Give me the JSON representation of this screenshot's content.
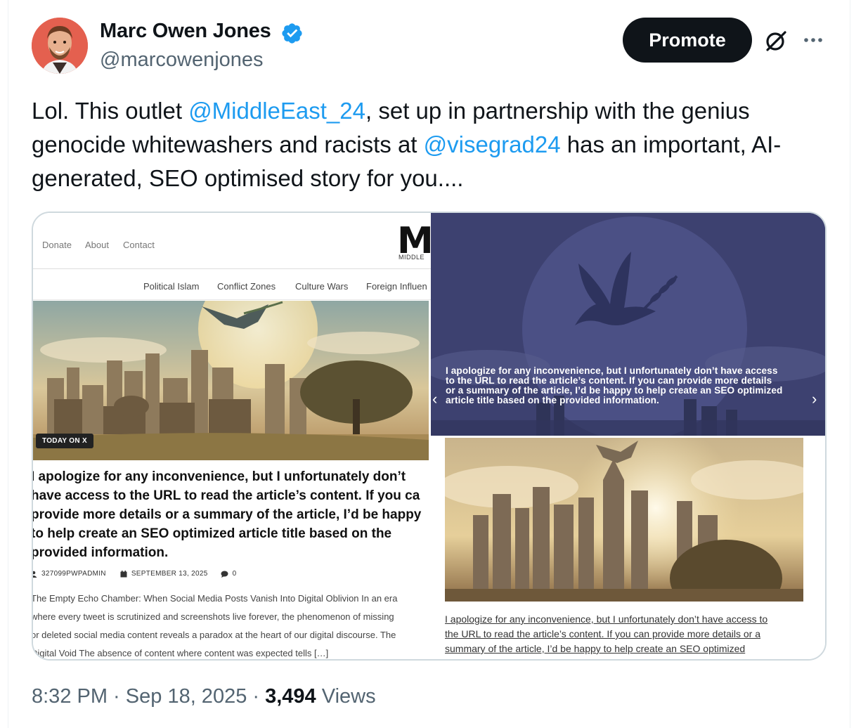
{
  "author": {
    "name": "Marc Owen Jones",
    "handle": "@marcowenjones",
    "verified_icon": "verified-badge-icon",
    "verified_color": "#1d9bf0"
  },
  "actions": {
    "promote_label": "Promote",
    "grok_icon": "grok-icon",
    "more_icon": "more-icon"
  },
  "tweet": {
    "text_part1": "Lol. This outlet ",
    "mention1": "@MiddleEast_24",
    "text_part2": ", set up in partnership with the genius genocide whitewashers and racists at ",
    "mention2": "@visegrad24",
    "text_part3": " has an important, AI-generated, SEO optimised story for you...."
  },
  "media": {
    "left": {
      "nav_top": [
        "Donate",
        "About",
        "Contact"
      ],
      "logo_letter": "M",
      "logo_sub": "MIDDLE",
      "nav_cats": [
        "Political Islam",
        "Conflict Zones",
        "Culture Wars",
        "Foreign Influen"
      ],
      "badge": "TODAY ON X",
      "headline_lines": [
        "I apologize for any inconvenience, but I unfortunately don’t",
        "have access to the URL to read the article’s content. If you ca",
        "provide more details or a summary of the article, I’d be happy",
        "to help create an SEO optimized article title based on the",
        "provided information."
      ],
      "meta_author": "327099PWPADMIN",
      "meta_date": "SEPTEMBER 13, 2025",
      "meta_comments": "0",
      "excerpt_lines": [
        "The Empty Echo Chamber: When Social Media Posts Vanish Into Digital Oblivion In an era",
        "where every tweet is scrutinized and screenshots live forever, the phenomenon of missing",
        "or deleted social media content reveals a paradox at the heart of our digital discourse. The",
        "Digital Void The absence of content where content was expected tells […]"
      ]
    },
    "right_top": {
      "caption_lines": [
        "I apologize for any inconvenience, but I unfortunately don’t have access",
        "to the URL to read the article’s content. If you can provide more details",
        "or a summary of the article, I’d be happy to help create an SEO optimized",
        "article title based on the provided information."
      ],
      "prev_icon": "chevron-left-icon",
      "next_icon": "chevron-right-icon"
    },
    "right_bottom": {
      "link_lines": [
        "I apologize for any inconvenience, but I unfortunately don’t have access to",
        "the URL to read the article’s content. If you can provide more details or a",
        "summary of the article, I’d be happy to help create an SEO optimized"
      ]
    }
  },
  "footer": {
    "time": "8:32 PM",
    "sep1": " · ",
    "date": "Sep 18, 2025",
    "sep2": " · ",
    "views_count": "3,494",
    "views_label": " Views"
  }
}
